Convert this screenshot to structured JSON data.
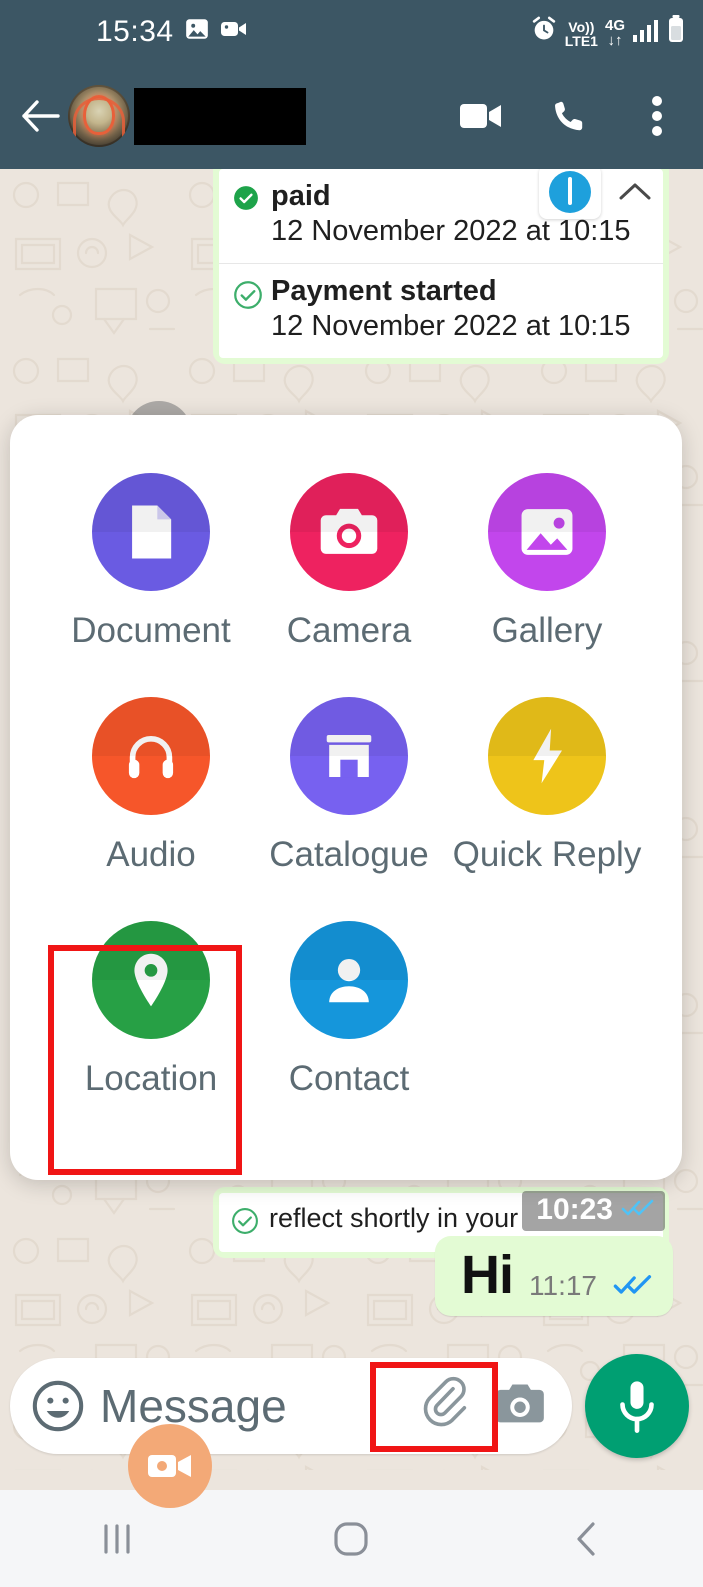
{
  "status_bar": {
    "clock": "15:34",
    "icons_left": [
      "image-icon",
      "video-camera-icon"
    ],
    "alarm_icon": "alarm-icon",
    "volte_line1": "Vo))",
    "volte_line2": "LTE1",
    "network_line1": "4G",
    "network_line2": "↓↑",
    "signal_icon": "signal-bars-icon",
    "battery_icon": "battery-icon",
    "background_color": "#3C5664"
  },
  "chat_header": {
    "back_icon": "back-arrow-icon",
    "avatar_icon": "contact-avatar",
    "contact_name": "",
    "contact_name_redacted": true,
    "video_call_icon": "video-call-icon",
    "voice_call_icon": "phone-call-icon",
    "more_options_icon": "more-vertical-icon",
    "background_color": "#3C5664"
  },
  "chat": {
    "forward_icon": "forward-arrow-icon",
    "payment_card": {
      "rows": [
        {
          "status_icon": "check-circle-filled-icon",
          "title": "paid",
          "timestamp": "12 November 2022 at 10:15"
        },
        {
          "status_icon": "check-circle-outline-icon",
          "title": "Payment started",
          "timestamp": "12 November 2022 at 10:15"
        }
      ],
      "bank_icon": "bank-logo-icon",
      "collapse_icon": "chevron-up-icon"
    },
    "reflect_message": {
      "text": "reflect shortly in your",
      "time": "10:23",
      "read_icon": "double-check-blue-icon"
    },
    "outgoing_message": {
      "text": "Hi",
      "time": "11:17",
      "read_icon": "double-check-blue-icon",
      "bubble_color": "#E3FBD4"
    }
  },
  "attachment_sheet": {
    "rows": [
      [
        {
          "label": "Document",
          "icon": "document-icon",
          "color": "#6A5BE2"
        },
        {
          "label": "Camera",
          "icon": "camera-icon",
          "color": "#EE2260"
        },
        {
          "label": "Gallery",
          "icon": "gallery-icon",
          "color": "#C246EC"
        }
      ],
      [
        {
          "label": "Audio",
          "icon": "headphones-icon",
          "color": "#F6562A"
        },
        {
          "label": "Catalogue",
          "icon": "storefront-icon",
          "color": "#7761F0"
        },
        {
          "label": "Quick Reply",
          "icon": "lightning-bolt-icon",
          "color": "#EEC41A"
        }
      ],
      [
        {
          "label": "Location",
          "icon": "location-pin-icon",
          "color": "#27A045"
        },
        {
          "label": "Contact",
          "icon": "person-icon",
          "color": "#1596DB"
        }
      ]
    ]
  },
  "highlights": {
    "color": "#F01515",
    "targets": [
      "Location",
      "attachment-paperclip-button"
    ]
  },
  "input_bar": {
    "emoji_icon": "emoji-smiley-icon",
    "placeholder": "Message",
    "value": "",
    "attach_icon": "paperclip-icon",
    "camera_icon": "camera-icon",
    "mic_icon": "microphone-icon",
    "mic_color": "#009F72",
    "video_fab_icon": "video-call-floating-icon"
  },
  "nav_bar": {
    "recents_icon": "recents-icon",
    "home_icon": "home-icon",
    "back_icon": "nav-back-icon",
    "background_color": "#F5F6F8"
  }
}
